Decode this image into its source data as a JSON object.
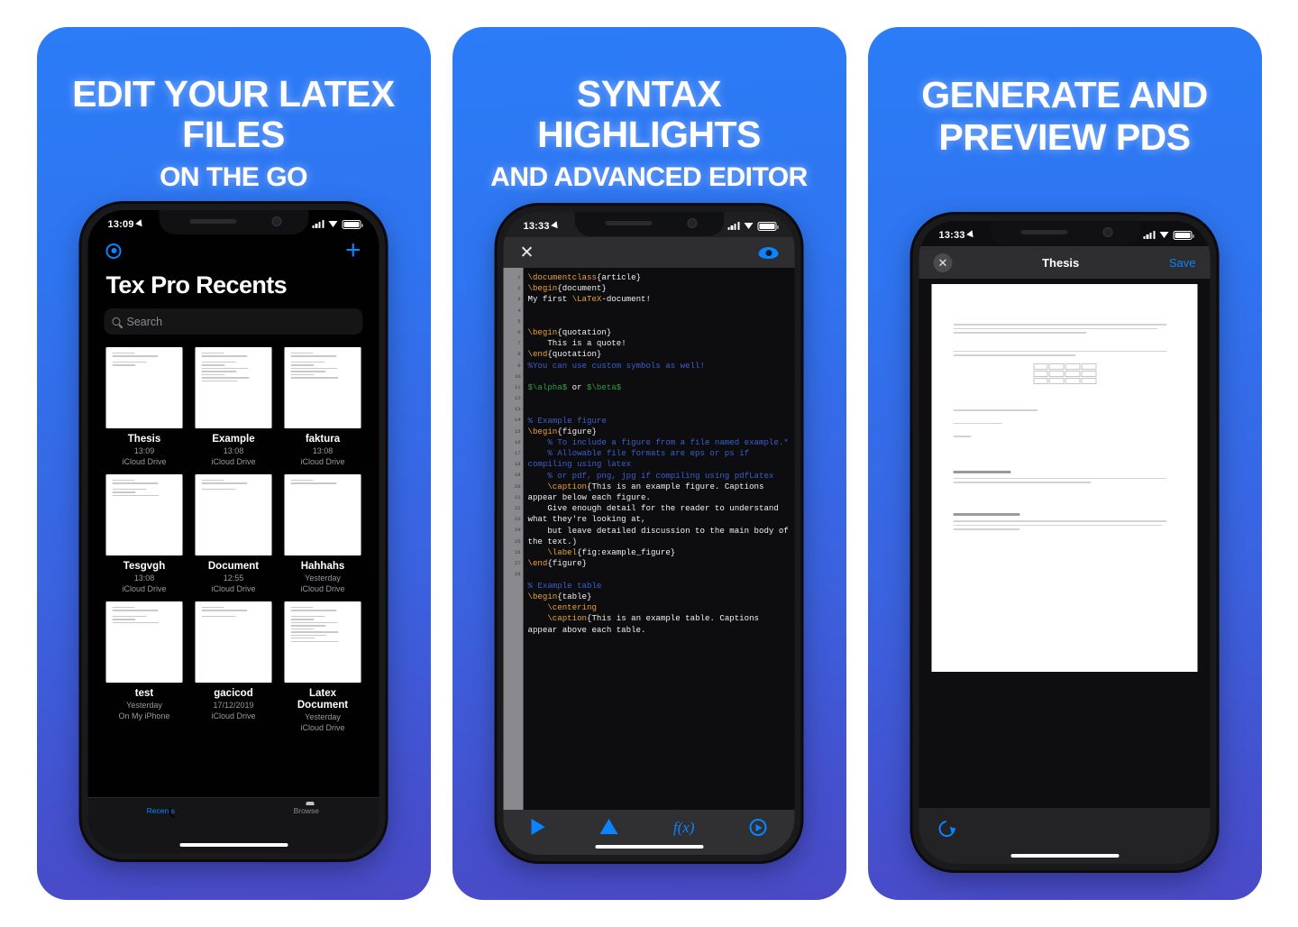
{
  "panels": [
    {
      "headline_top": "EDIT YOUR LATEX FILES",
      "headline_bottom": "ON THE GO",
      "status": {
        "time": "13:09"
      },
      "nav": {
        "settings_icon": "gear-icon",
        "add_icon": "plus-icon"
      },
      "title": "Tex Pro Recents",
      "search_placeholder": "Search",
      "files": [
        {
          "name": "Thesis",
          "time": "13:09",
          "location": "iCloud Drive"
        },
        {
          "name": "Example",
          "time": "13:08",
          "location": "iCloud Drive"
        },
        {
          "name": "faktura",
          "time": "13:08",
          "location": "iCloud Drive"
        },
        {
          "name": "Tesgvgh",
          "time": "13:08",
          "location": "iCloud Drive"
        },
        {
          "name": "Document",
          "time": "12:55",
          "location": "iCloud Drive"
        },
        {
          "name": "Hahhahs",
          "time": "Yesterday",
          "location": "iCloud Drive"
        },
        {
          "name": "test",
          "time": "Yesterday",
          "location": "On My iPhone"
        },
        {
          "name": "gacicod",
          "time": "17/12/2019",
          "location": "iCloud Drive"
        },
        {
          "name": "Latex Document",
          "time": "Yesterday",
          "location": "iCloud Drive"
        }
      ],
      "tabs": [
        {
          "label": "Recents",
          "icon": "clock-icon",
          "active": true
        },
        {
          "label": "Browse",
          "icon": "folder-icon",
          "active": false
        }
      ]
    },
    {
      "headline_top": "SYNTAX HIGHLIGHTS",
      "headline_bottom": "AND ADVANCED EDITOR",
      "status": {
        "time": "13:33"
      },
      "nav": {
        "close_label": "✕",
        "preview_icon": "eye-icon"
      },
      "line_numbers": [
        1,
        2,
        3,
        4,
        5,
        6,
        7,
        8,
        9,
        10,
        11,
        12,
        13,
        14,
        15,
        16,
        17,
        18,
        19,
        20,
        21,
        22,
        23,
        24,
        25,
        26,
        27,
        28
      ],
      "code_lines": [
        "\\documentclass{article}",
        "\\begin{document}",
        "My first \\LaTeX-document!",
        "",
        "",
        "\\begin{quotation}",
        "    This is a quote!",
        "\\end{quotation}",
        "%You can use custom symbols as well!",
        "",
        "$\\alpha$ or $\\beta$",
        "",
        "",
        "% Example figure",
        "\\begin{figure}",
        "    % To include a figure from a file named example.*",
        "    % Allowable file formats are eps or ps if compiling using latex",
        "    % or pdf, png, jpg if compiling using pdfLatex",
        "    \\caption{This is an example figure. Captions appear below each figure.",
        "    Give enough detail for the reader to understand what they're looking at,",
        "    but leave detailed discussion to the main body of the text.)",
        "    \\label{fig:example_figure}",
        "\\end{figure}",
        "",
        "% Example table",
        "\\begin{table}",
        "    \\centering",
        "    \\caption{This is an example table. Captions appear above each table."
      ],
      "toolbar": [
        {
          "icon": "play-icon"
        },
        {
          "icon": "warning-triangle-icon"
        },
        {
          "icon": "function-fx-icon"
        },
        {
          "icon": "circle-play-icon"
        }
      ]
    },
    {
      "headline_top": "GENERATE AND",
      "headline_bottom": "PREVIEW PDS",
      "status": {
        "time": "13:33"
      },
      "nav": {
        "close_label": "✕",
        "title": "Thesis",
        "save_label": "Save"
      },
      "bottom": {
        "reload_icon": "reload-icon"
      }
    }
  ],
  "colors": {
    "accent": "#0a84ff",
    "panel_gradient_top": "#2b7cf7",
    "panel_gradient_bottom": "#4a4ac6",
    "page_background": "#ffffff"
  }
}
